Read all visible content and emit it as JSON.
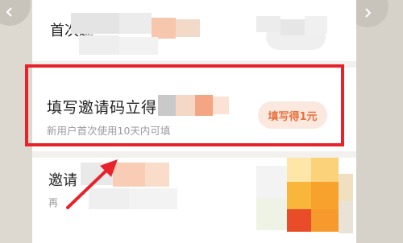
{
  "nav": {
    "back_icon": "chevron-left-icon",
    "forward_icon": "chevron-right-icon"
  },
  "rows": {
    "top": {
      "title": "首次邀"
    },
    "invite_code": {
      "title": "填写邀请码立得",
      "subtitle": "新用户首次使用10天内可填",
      "button_label": "填写得1元"
    },
    "bottom": {
      "title": "邀请",
      "subtitle": "再"
    }
  },
  "colors": {
    "highlight": "#e8222b",
    "accent": "#e8703b",
    "button_bg": "#fbe9df"
  }
}
